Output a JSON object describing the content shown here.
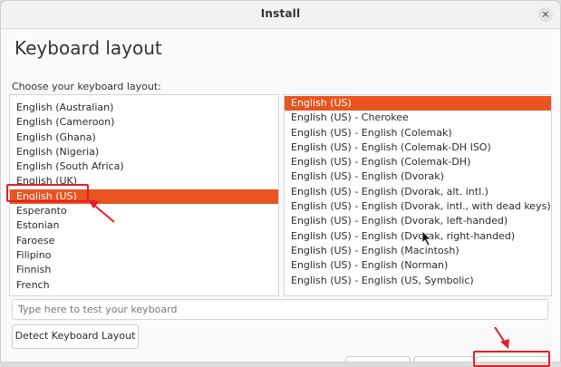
{
  "window": {
    "title": "Install",
    "close_glyph": "×"
  },
  "heading": "Keyboard layout",
  "subheading": "Choose your keyboard layout:",
  "layouts": [
    "English (Australian)",
    "English (Cameroon)",
    "English (Ghana)",
    "English (Nigeria)",
    "English (South Africa)",
    "English (UK)",
    "English (US)",
    "Esperanto",
    "Estonian",
    "Faroese",
    "Filipino",
    "Finnish",
    "French"
  ],
  "selected_layout": "English (US)",
  "variants": [
    "English (US)",
    "English (US) - Cherokee",
    "English (US) - English (Colemak)",
    "English (US) - English (Colemak-DH ISO)",
    "English (US) - English (Colemak-DH)",
    "English (US) - English (Dvorak)",
    "English (US) - English (Dvorak, alt. intl.)",
    "English (US) - English (Dvorak, intl., with dead keys)",
    "English (US) - English (Dvorak, left-handed)",
    "English (US) - English (Dvorak, right-handed)",
    "English (US) - English (Macintosh)",
    "English (US) - English (Norman)",
    "English (US) - English (US, Symbolic)"
  ],
  "selected_variant": "English (US)",
  "test_input": {
    "placeholder": "Type here to test your keyboard",
    "value": ""
  },
  "detect_button": "Detect Keyboard Layout",
  "colors": {
    "accent": "#e95420",
    "annotation": "#e0202a"
  }
}
